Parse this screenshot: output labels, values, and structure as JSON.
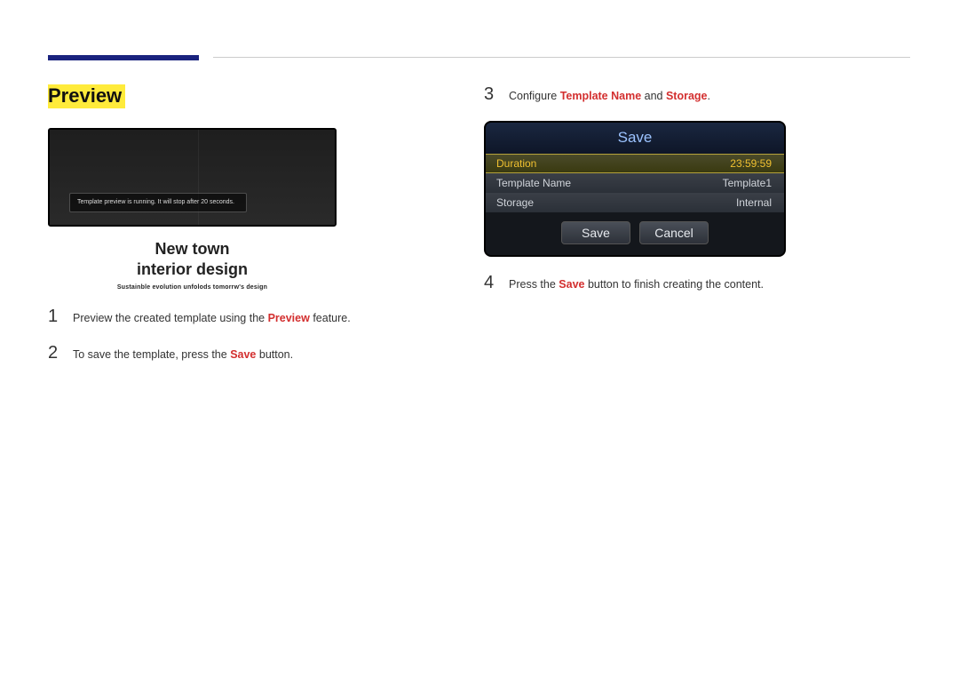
{
  "sectionTitle": "Preview",
  "previewToast": "Template preview is running. It will stop after 20 seconds.",
  "caption": {
    "line1": "New town",
    "line2": "interior design",
    "sub": "Sustainble evolution unfolods tomorrw's design"
  },
  "steps": [
    {
      "num": "1",
      "pre": "Preview the created template using the ",
      "hl": "Preview",
      "post": " feature."
    },
    {
      "num": "2",
      "pre": "To save the template, press the ",
      "hl": "Save",
      "post": " button."
    },
    {
      "num": "3",
      "pre": "Configure ",
      "hl": "Template Name",
      "mid": " and ",
      "hl2": "Storage",
      "post": "."
    },
    {
      "num": "4",
      "pre": "Press the ",
      "hl": "Save",
      "post": " button to finish creating the content."
    }
  ],
  "saveDialog": {
    "title": "Save",
    "rows": [
      {
        "label": "Duration",
        "value": "23:59:59",
        "selected": true
      },
      {
        "label": "Template Name",
        "value": "Template1",
        "selected": false
      },
      {
        "label": "Storage",
        "value": "Internal",
        "selected": false
      }
    ],
    "buttons": {
      "save": "Save",
      "cancel": "Cancel"
    }
  }
}
